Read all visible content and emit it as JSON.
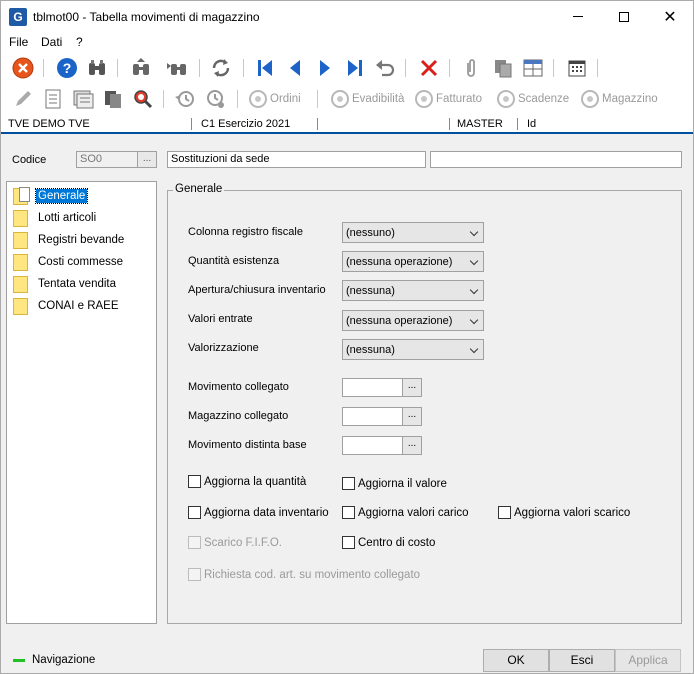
{
  "window": {
    "title": "tblmot00 - Tabella movimenti di magazzino",
    "app_icon_letter": "G"
  },
  "menu": [
    "File",
    "Dati",
    "?"
  ],
  "toolbar2_labels": {
    "ordini": "Ordini",
    "evadibilita": "Evadibilità",
    "fatturato": "Fatturato",
    "scadenze": "Scadenze",
    "magazzino": "Magazzino"
  },
  "statusline": {
    "company": "TVE DEMO TVE",
    "exercise": "C1 Esercizio 2021",
    "user": "MASTER",
    "id": "Id"
  },
  "codice": {
    "label": "Codice",
    "code_value": "SO0",
    "description": "Sostituzioni da sede",
    "extra": "",
    "lookup_label": "..."
  },
  "tree": [
    {
      "label": "Generale",
      "selected": true
    },
    {
      "label": "Lotti articoli"
    },
    {
      "label": "Registri bevande"
    },
    {
      "label": "Costi commesse"
    },
    {
      "label": "Tentata vendita"
    },
    {
      "label": "CONAI e RAEE"
    }
  ],
  "general": {
    "title": "Generale",
    "selects": [
      {
        "label": "Colonna registro fiscale",
        "value": "(nessuno)"
      },
      {
        "label": "Quantità esistenza",
        "value": "(nessuna operazione)"
      },
      {
        "label": "Apertura/chiusura inventario",
        "value": "(nessuna)"
      },
      {
        "label": "Valori entrate",
        "value": "(nessuna operazione)"
      },
      {
        "label": "Valorizzazione",
        "value": "(nessuna)"
      }
    ],
    "lookups": [
      {
        "label": "Movimento collegato",
        "value": "",
        "btn": "..."
      },
      {
        "label": "Magazzino collegato",
        "value": "",
        "btn": "..."
      },
      {
        "label": "Movimento distinta base",
        "value": "",
        "btn": "..."
      }
    ],
    "checkboxes": {
      "aggiorna_quantita": "Aggiorna la quantità",
      "aggiorna_valore": "Aggiorna il valore",
      "aggiorna_data_inventario": "Aggiorna data inventario",
      "aggiorna_valori_carico": "Aggiorna valori carico",
      "aggiorna_valori_scarico": "Aggiorna valori scarico",
      "scarico_fifo": "Scarico F.I.F.O.",
      "centro_di_costo": "Centro di costo",
      "richiesta_cod_art": "Richiesta cod. art. su movimento collegato"
    }
  },
  "footer": {
    "status": "Navigazione",
    "ok": "OK",
    "esci": "Esci",
    "applica": "Applica"
  },
  "colors": {
    "accent_blue": "#0050a0",
    "selection": "#0078d7",
    "folder_yellow": "#ffe680",
    "status_green": "#22c022"
  }
}
